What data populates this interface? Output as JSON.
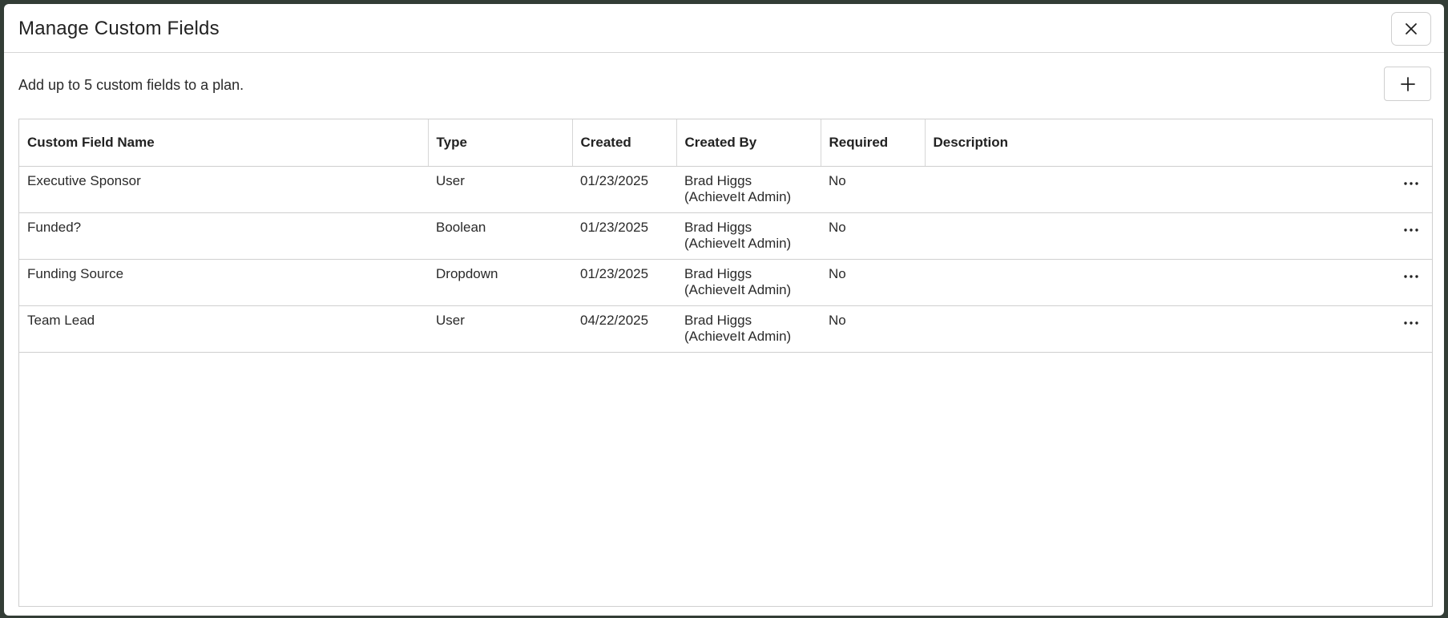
{
  "modal": {
    "title": "Manage Custom Fields",
    "intro": "Add up to 5 custom fields to a plan."
  },
  "icons": {
    "close": "close-icon",
    "add": "plus-icon",
    "row_menu": "ellipsis-icon"
  },
  "table": {
    "headers": {
      "name": "Custom Field Name",
      "type": "Type",
      "created": "Created",
      "created_by": "Created By",
      "required": "Required",
      "description": "Description"
    },
    "rows": [
      {
        "name": "Executive Sponsor",
        "type": "User",
        "created": "01/23/2025",
        "created_by_name": "Brad Higgs",
        "created_by_role": "(AchieveIt Admin)",
        "required": "No",
        "description": ""
      },
      {
        "name": "Funded?",
        "type": "Boolean",
        "created": "01/23/2025",
        "created_by_name": "Brad Higgs",
        "created_by_role": "(AchieveIt Admin)",
        "required": "No",
        "description": ""
      },
      {
        "name": "Funding Source",
        "type": "Dropdown",
        "created": "01/23/2025",
        "created_by_name": "Brad Higgs",
        "created_by_role": "(AchieveIt Admin)",
        "required": "No",
        "description": ""
      },
      {
        "name": "Team Lead",
        "type": "User",
        "created": "04/22/2025",
        "created_by_name": "Brad Higgs",
        "created_by_role": "(AchieveIt Admin)",
        "required": "No",
        "description": ""
      }
    ]
  }
}
